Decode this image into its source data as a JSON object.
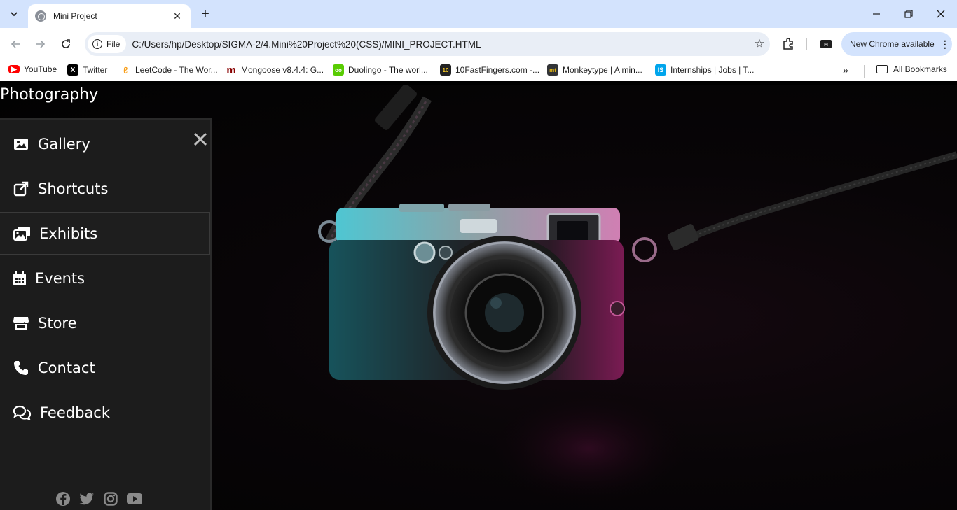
{
  "browser": {
    "tab_title": "Mini Project",
    "tab_close": "✕",
    "new_tab": "+",
    "window": {
      "minimize": "—",
      "restore": "❐",
      "close": "✕"
    },
    "chip_label": "File",
    "url": "C:/Users/hp/Desktop/SIGMA-2/4.Mini%20Project%20(CSS)/MINI_PROJECT.HTML",
    "update_label": "New Chrome available",
    "bookmarks": [
      {
        "label": "YouTube",
        "icon": "youtube-icon",
        "color": "#ff0000"
      },
      {
        "label": "Twitter",
        "icon": "x-icon",
        "color": "#000000"
      },
      {
        "label": "LeetCode - The Wor...",
        "icon": "leetcode-icon",
        "color": "#f89f1b"
      },
      {
        "label": "Mongoose v8.4.4: G...",
        "icon": "mongoose-icon",
        "color": "#880000"
      },
      {
        "label": "Duolingo - The worl...",
        "icon": "duolingo-icon",
        "color": "#58cc02"
      },
      {
        "label": "10FastFingers.com -...",
        "icon": "tenfastfingers-icon",
        "color": "#222222"
      },
      {
        "label": "Monkeytype | A min...",
        "icon": "monkeytype-icon",
        "color": "#323437"
      },
      {
        "label": "Internships | Jobs | T...",
        "icon": "internshala-icon",
        "color": "#00a5ec"
      }
    ],
    "bookmarks_more": "»",
    "all_bookmarks": "All Bookmarks"
  },
  "page": {
    "brand": "Photography",
    "close_glyph": "✕",
    "menu": [
      {
        "label": "Gallery",
        "icon": "image-icon"
      },
      {
        "label": "Shortcuts",
        "icon": "external-link-icon"
      },
      {
        "label": "Exhibits",
        "icon": "photo-stack-icon"
      },
      {
        "label": "Events",
        "icon": "calendar-icon"
      },
      {
        "label": "Store",
        "icon": "store-icon"
      },
      {
        "label": "Contact",
        "icon": "phone-icon"
      },
      {
        "label": "Feedback",
        "icon": "comments-icon"
      }
    ],
    "active_item": "Exhibits",
    "social": [
      "facebook-icon",
      "twitter-icon",
      "instagram-icon",
      "youtube-icon"
    ]
  }
}
